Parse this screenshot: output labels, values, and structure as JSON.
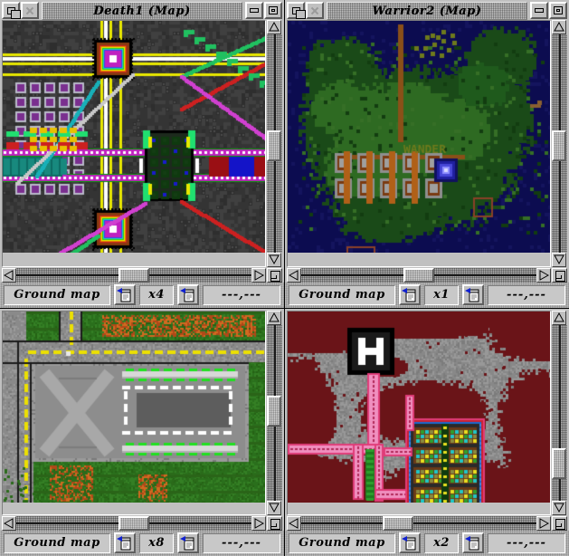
{
  "app": {
    "background_color": "#000000",
    "chrome_face": "#c0c0c0"
  },
  "windows": [
    {
      "id": "death1",
      "title": "Death1 (Map)",
      "titlebar_buttons": {
        "restore": "restore-icon",
        "close": "close-icon",
        "minimize": "minimize-icon",
        "maximize": "maximize-icon"
      },
      "toolbar": {
        "mode_label": "Ground map",
        "zoom_out_icon": "zoom-out-icon",
        "zoom_level": "x4",
        "zoom_in_icon": "zoom-in-icon",
        "coordinates": "---,---"
      },
      "scrollbars": {
        "vertical": true,
        "horizontal": true,
        "size_grip": true
      }
    },
    {
      "id": "warrior2",
      "title": "Warrior2 (Map)",
      "titlebar_buttons": {
        "restore": "restore-icon",
        "close": "close-icon",
        "minimize": "minimize-icon",
        "maximize": "maximize-icon"
      },
      "toolbar": {
        "mode_label": "Ground map",
        "zoom_out_icon": "zoom-out-icon",
        "zoom_level": "x1",
        "zoom_in_icon": "zoom-in-icon",
        "coordinates": "---,---"
      },
      "scrollbars": {
        "vertical": true,
        "horizontal": true,
        "size_grip": true
      },
      "map_annotation": "WANDER"
    },
    {
      "id": "bottomleft",
      "title": "",
      "toolbar": {
        "mode_label": "Ground map",
        "zoom_out_icon": "zoom-out-icon",
        "zoom_level": "x8",
        "zoom_in_icon": "zoom-in-icon",
        "coordinates": "---,---"
      },
      "scrollbars": {
        "vertical": true,
        "horizontal": true,
        "size_grip": true
      }
    },
    {
      "id": "bottomright",
      "title": "",
      "toolbar": {
        "mode_label": "Ground map",
        "zoom_out_icon": "zoom-out-icon",
        "zoom_level": "x2",
        "zoom_in_icon": "zoom-in-icon",
        "coordinates": "---,---"
      },
      "scrollbars": {
        "vertical": true,
        "horizontal": true,
        "size_grip": true
      },
      "map_annotation": "H"
    }
  ]
}
